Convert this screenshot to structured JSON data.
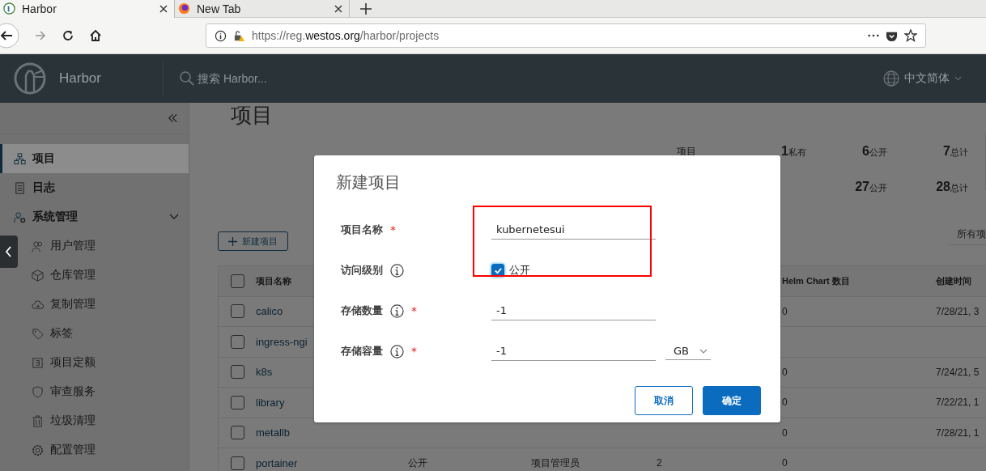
{
  "browser": {
    "tabs": [
      {
        "title": "Harbor",
        "selected": true
      },
      {
        "title": "New Tab",
        "selected": false
      }
    ],
    "url": {
      "prefix": "https://reg.",
      "domain": "westos.org",
      "path": "/harbor/projects"
    }
  },
  "app_header": {
    "brand": "Harbor",
    "search": {
      "placeholder": "搜索 Harbor..."
    },
    "language": "中文简体"
  },
  "sidebar": {
    "items": [
      {
        "label": "项目",
        "selected": true
      },
      {
        "label": "日志",
        "selected": false
      },
      {
        "label": "系统管理",
        "selected": false,
        "expanded": true,
        "children": [
          {
            "label": "用户管理",
            "selected": false
          },
          {
            "label": "仓库管理",
            "selected": false
          },
          {
            "label": "复制管理",
            "selected": false
          },
          {
            "label": "标签",
            "selected": false
          },
          {
            "label": "项目定额",
            "selected": false
          },
          {
            "label": "审查服务",
            "selected": false
          },
          {
            "label": "垃圾清理",
            "selected": false
          },
          {
            "label": "配置管理",
            "selected": false
          }
        ]
      }
    ]
  },
  "page": {
    "title": "项目",
    "stats": [
      {
        "label": "项目",
        "values": [
          {
            "number": "1",
            "unit": "私有"
          },
          {
            "number": "6",
            "unit": "公开"
          },
          {
            "number": "7",
            "unit": "总计"
          }
        ]
      },
      {
        "values": [
          {
            "number": "27",
            "unit": "公开"
          },
          {
            "number": "28",
            "unit": "总计"
          }
        ]
      }
    ],
    "new_button": "新建项目",
    "filter": "所有项",
    "table": {
      "columns": [
        "项目名称",
        "",
        "",
        "",
        "Helm Chart 数目",
        "创建时间"
      ],
      "header_checked": false,
      "rows": [
        {
          "checked": false,
          "cells": [
            "calico",
            "",
            "",
            "",
            "0",
            "7/28/21, 3"
          ]
        },
        {
          "checked": false,
          "cells": [
            "ingress-ngi",
            "",
            "",
            "",
            "",
            ""
          ]
        },
        {
          "checked": false,
          "cells": [
            "k8s",
            "",
            "",
            "",
            "0",
            "7/24/21, 5"
          ]
        },
        {
          "checked": false,
          "cells": [
            "library",
            "",
            "",
            "",
            "0",
            "7/22/21, 1"
          ]
        },
        {
          "checked": false,
          "cells": [
            "metallb",
            "",
            "",
            "",
            "0",
            "7/28/21, 1"
          ]
        },
        {
          "checked": false,
          "cells": [
            "portainer",
            "公开",
            "项目管理员",
            "2",
            "0",
            ""
          ]
        }
      ]
    }
  },
  "dialog": {
    "title": "新建项目",
    "fields": [
      {
        "kind": "text",
        "label": "项目名称",
        "required_mark": "*",
        "info": false,
        "value": "kubernetesui"
      },
      {
        "kind": "checkbox",
        "label": "访问级别",
        "info": true,
        "checked": true,
        "option": "公开"
      },
      {
        "kind": "text",
        "label": "存储数量",
        "required_mark": "*",
        "info": true,
        "value": "-1"
      },
      {
        "kind": "unit",
        "label": "存储容量",
        "required_mark": "*",
        "info": true,
        "value": "-1",
        "unit": "GB"
      }
    ],
    "buttons": [
      {
        "kind": "secondary",
        "label": "取消"
      },
      {
        "kind": "primary",
        "label": "确定"
      }
    ]
  }
}
